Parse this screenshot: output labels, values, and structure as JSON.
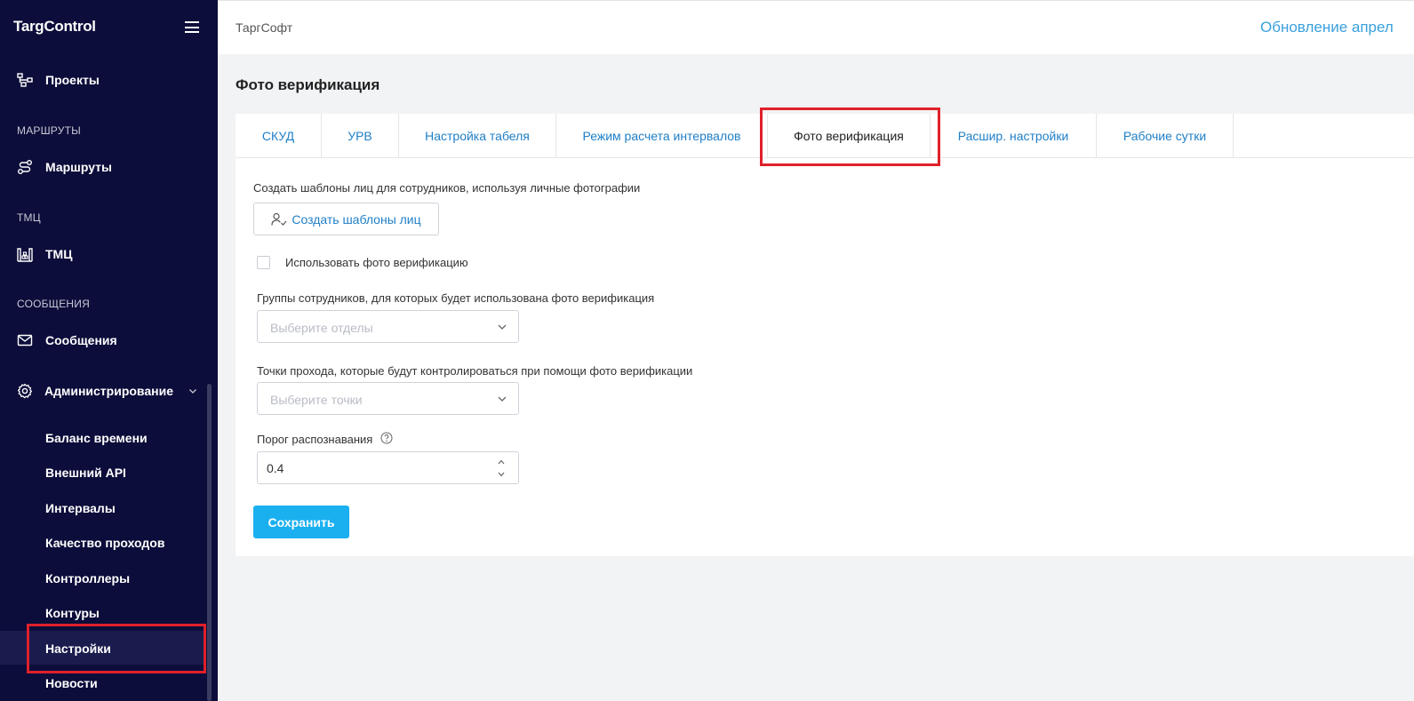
{
  "app": {
    "logo": "TargControl"
  },
  "header": {
    "company": "ТаргСофт",
    "update_link": "Обновление апрел"
  },
  "sidebar": {
    "items": [
      {
        "label": "Проекты",
        "icon": "projects-icon"
      },
      {
        "section": "МАРШРУТЫ"
      },
      {
        "label": "Маршруты",
        "icon": "route-icon"
      },
      {
        "section": "ТМЦ"
      },
      {
        "label": "ТМЦ",
        "icon": "warehouse-icon"
      },
      {
        "section": "СООБЩЕНИЯ"
      },
      {
        "label": "Сообщения",
        "icon": "mail-icon"
      },
      {
        "label": "Администрирование",
        "icon": "gear-icon"
      }
    ],
    "admin_subitems": [
      "Баланс времени",
      "Внешний API",
      "Интервалы",
      "Качество проходов",
      "Контроллеры",
      "Контуры",
      "Настройки",
      "Новости"
    ],
    "active_subitem": "Настройки"
  },
  "page": {
    "title": "Фото верификация"
  },
  "tabs": [
    "СКУД",
    "УРВ",
    "Настройка табеля",
    "Режим расчета интервалов",
    "Фото верификация",
    "Расшир. настройки",
    "Рабочие сутки"
  ],
  "active_tab": "Фото верификация",
  "form": {
    "create_templates_desc": "Создать шаблоны лиц для сотрудников, используя личные фотографии",
    "create_templates_button": "Создать шаблоны лиц",
    "use_photo_label": "Использовать фото верификацию",
    "use_photo_checked": false,
    "groups_label": "Группы сотрудников, для которых будет использована фото верификация",
    "groups_placeholder": "Выберите отделы",
    "points_label": "Точки прохода, которые будут контролироваться при помощи фото верификации",
    "points_placeholder": "Выберите точки",
    "threshold_label": "Порог распознавания",
    "threshold_value": "0.4",
    "save_button": "Сохранить"
  },
  "colors": {
    "sidebar_bg": "#0c0d3a",
    "accent": "#1ab0f0",
    "link": "#1f7fc7",
    "highlight": "#e0202a"
  }
}
